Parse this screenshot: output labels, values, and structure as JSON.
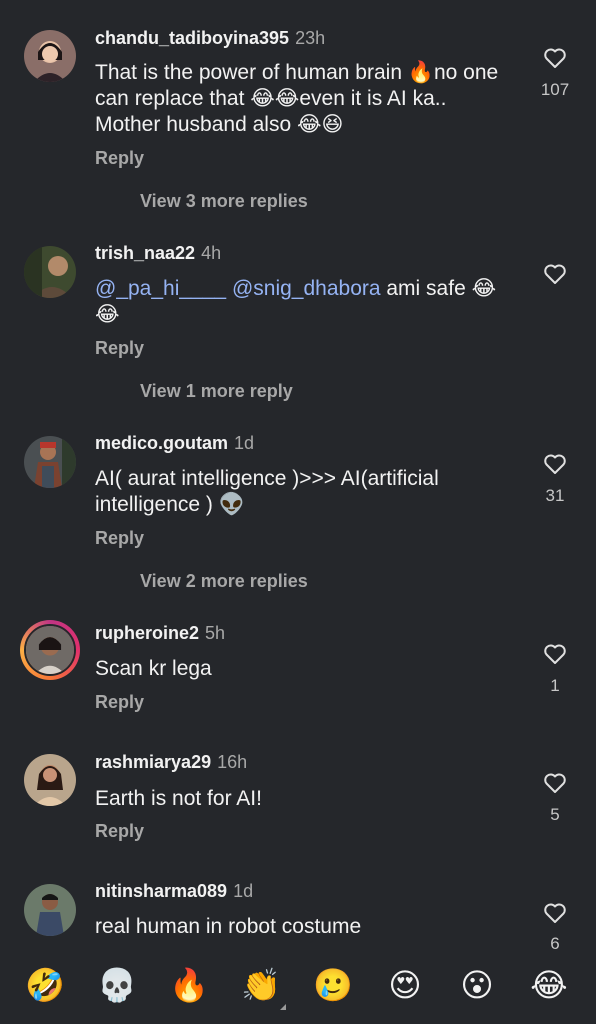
{
  "comments": [
    {
      "username": "chandu_tadiboyina395",
      "time": "23h",
      "text": "That is the power of human brain 🔥no one can replace that 😂😂even it is AI ka.. Mother husband also 😂😆",
      "reply": "Reply",
      "more": "View 3 more replies",
      "likes": "107"
    },
    {
      "username": "trish_naa22",
      "time": "4h",
      "mention1": "@_pa_hi____",
      "mention2": "@snig_dhabora",
      "text_rest": " ami safe 😂😂",
      "reply": "Reply",
      "more": "View 1 more reply",
      "likes": ""
    },
    {
      "username": "medico.goutam",
      "time": "1d",
      "text": "AI( aurat intelligence )>>> AI(artificial intelligence ) 👽",
      "reply": "Reply",
      "more": "View 2 more replies",
      "likes": "31"
    },
    {
      "username": "rupheroine2",
      "time": "5h",
      "text": "Scan kr lega",
      "reply": "Reply",
      "likes": "1"
    },
    {
      "username": "rashmiarya29",
      "time": "16h",
      "text": "Earth is not for AI!",
      "reply": "Reply",
      "likes": "5"
    },
    {
      "username": "nitinsharma089",
      "time": "1d",
      "text": "real human in robot costume",
      "likes": "6"
    }
  ],
  "reactions": [
    "🤣",
    "💀",
    "🔥",
    "👏",
    "🥲",
    "😍",
    "😮",
    "😂"
  ],
  "icons": {
    "heart": "heart-outline-icon"
  }
}
